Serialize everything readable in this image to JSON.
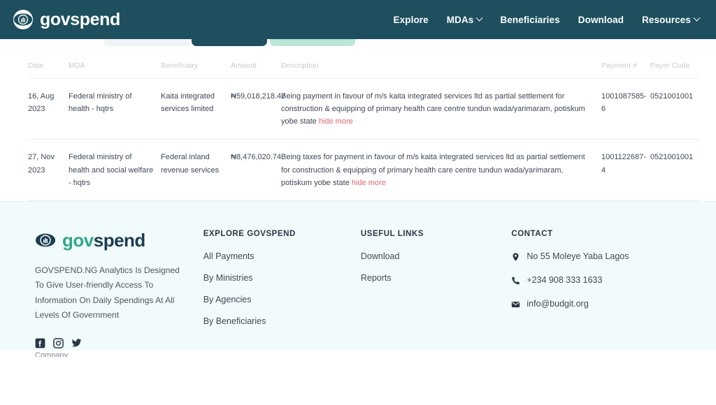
{
  "header": {
    "brand": "govspend",
    "brand_icon": "eye-icon",
    "nav": [
      {
        "label": "Explore",
        "caret": false
      },
      {
        "label": "MDAs",
        "caret": true
      },
      {
        "label": "Beneficiaries",
        "caret": false
      },
      {
        "label": "Download",
        "caret": false
      },
      {
        "label": "Resources",
        "caret": true
      }
    ]
  },
  "tabs": [
    {
      "name": "tab-chip-grey",
      "color": "#f1f2f3"
    },
    {
      "name": "tab-chip-active",
      "color": "#1d4f5e"
    },
    {
      "name": "tab-chip-green",
      "color": "#b9e6d6"
    }
  ],
  "table": {
    "columns": [
      "Date",
      "MDA",
      "Beneficiary",
      "Amount",
      "Description",
      "Payment #",
      "Payer Code"
    ],
    "rows": [
      {
        "date": "16, Aug 2023",
        "mda": "Federal ministry of health - hqtrs",
        "beneficiary": "Kaita integrated services limited",
        "amount": "₦59,018,218.47",
        "description": "Being payment in favour of m/s kaita integrated services ltd as partial settlement for construction & equipping of primary health care centre tundun wada/yarimaram, potiskum yobe state ",
        "toggle": "hide more",
        "payment_no": "1001087585-6",
        "payer_code": "0521001001"
      },
      {
        "date": "27, Nov 2023",
        "mda": "Federal ministry of health and social welfare - hqtrs",
        "beneficiary": "Federal inland revenue services",
        "amount": "₦8,476,020.74",
        "description": "Being taxes for payment in favour of m/s kaita integrated services ltd as partial settlement for construction & equipping of primary health care centre tundun wada/yarimaram, potiskum yobe state ",
        "toggle": "hide more",
        "payment_no": "1001122687-4",
        "payer_code": "0521001001"
      }
    ]
  },
  "footer": {
    "brand_gov": "gov",
    "brand_spend": "spend",
    "brand_icon": "eye-icon",
    "description": "GOVSPEND.NG Analytics Is Designed To Give User-friendly Access To Information On Daily Spendings At All Levels Of Government",
    "socials": [
      {
        "name": "facebook-icon"
      },
      {
        "name": "instagram-icon"
      },
      {
        "name": "twitter-icon"
      }
    ],
    "explore": {
      "heading": "EXPLORE GOVSPEND",
      "links": [
        "All Payments",
        "By Ministries",
        "By Agencies",
        "By Beneficiaries"
      ]
    },
    "useful": {
      "heading": "USEFUL LINKS",
      "links": [
        "Download",
        "Reports"
      ]
    },
    "contact": {
      "heading": "CONTACT",
      "address": "No 55 Moleye Yaba Lagos",
      "phone": "+234 908 333 1633",
      "email": "info@budgit.org"
    },
    "bottom_cut": "Company"
  },
  "colors": {
    "header_bg": "#1d4f5e",
    "footer_bg": "#f2fbfb",
    "accent_green": "#2fa98b",
    "link_red": "#e8636f",
    "text": "#3f4856"
  }
}
